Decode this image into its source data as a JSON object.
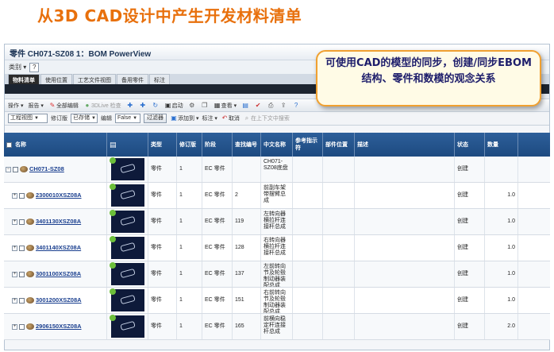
{
  "slide": {
    "title": "从3D CAD设计中产生开发材料清单"
  },
  "window": {
    "title": "零件 CH071-SZ08 1：BOM PowerView",
    "menu_label": "类别",
    "help_label": "?"
  },
  "tabs": [
    "物料清单",
    "使用位置",
    "工艺文件视图",
    "备用零件",
    "标注"
  ],
  "toolbar": {
    "ops_label": "操作",
    "report_label": "报告",
    "edit_all_label": "全部编辑",
    "live_label": "3DLive 检查",
    "launch_label": "启动",
    "view_label": "查看"
  },
  "toolbar2": {
    "view_select": "工程视图",
    "rev_label": "修订版",
    "rev_select": "已存储",
    "edit_label": "编辑",
    "edit_select": "False",
    "filter_button": "过滤器",
    "add_button": "添加到",
    "mark_button": "标注",
    "unmark_button": "取消",
    "context_search": "在上下文中搜索"
  },
  "columns": {
    "name": "名称",
    "type": "类型",
    "version": "修订版",
    "stage": "阶段",
    "seq": "查找编号",
    "cn_name": "中文名称",
    "ref": "参考指示符",
    "location": "部件位置",
    "desc": "描述",
    "status": "状态",
    "qty": "数量"
  },
  "rows": [
    {
      "name": "CH071-SZ08",
      "type": "零件",
      "version": "1",
      "stage": "EC 零件",
      "seq": "",
      "cn_name": "CH071-SZ08底盘",
      "status": "创建",
      "qty": ""
    },
    {
      "name": "2300010XSZ08A",
      "type": "零件",
      "version": "1",
      "stage": "EC 零件",
      "seq": "2",
      "cn_name": "前副车架带摆臂总成",
      "status": "创建",
      "qty": "1.0"
    },
    {
      "name": "3401130XSZ08A",
      "type": "零件",
      "version": "1",
      "stage": "EC 零件",
      "seq": "119",
      "cn_name": "左转向器横拉杆连接杆总成",
      "status": "创建",
      "qty": "1.0"
    },
    {
      "name": "3401140XSZ08A",
      "type": "零件",
      "version": "1",
      "stage": "EC 零件",
      "seq": "128",
      "cn_name": "右转向器横拉杆连接杆总成",
      "status": "创建",
      "qty": "1.0"
    },
    {
      "name": "3001100XSZ08A",
      "type": "零件",
      "version": "1",
      "stage": "EC 零件",
      "seq": "137",
      "cn_name": "左前转向节及轮毂制动器装配总成",
      "status": "创建",
      "qty": "1.0"
    },
    {
      "name": "3001200XSZ08A",
      "type": "零件",
      "version": "1",
      "stage": "EC 零件",
      "seq": "151",
      "cn_name": "右前转向节及轮毂制动器装配总成",
      "status": "创建",
      "qty": "1.0"
    },
    {
      "name": "2906150XSZ08A",
      "type": "零件",
      "version": "1",
      "stage": "EC 零件",
      "seq": "165",
      "cn_name": "前横向稳定杆连接杆总成",
      "status": "创建",
      "qty": "2.0"
    }
  ],
  "callout": {
    "text": "可使用CAD的模型的同步，创建/同步EBOM结构、零件和数模的观念关系"
  }
}
